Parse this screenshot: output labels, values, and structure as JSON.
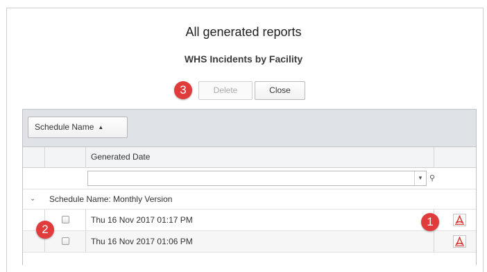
{
  "dialog": {
    "title": "All generated reports",
    "subtitle": "WHS Incidents by Facility"
  },
  "toolbar": {
    "delete_label": "Delete",
    "close_label": "Close"
  },
  "badges": {
    "one": "1",
    "two": "2",
    "three": "3",
    "color": "#e03c3c"
  },
  "grid": {
    "group_chip_label": "Schedule Name",
    "group_chip_sort_icon": "sort-ascending-icon",
    "column_header": "Generated Date",
    "filter_value": "",
    "group_row_label": "Schedule Name: Monthly Version",
    "rows": [
      {
        "date": "Thu 16 Nov 2017 01:17 PM",
        "icon": "pdf-icon"
      },
      {
        "date": "Thu 16 Nov 2017 01:06 PM",
        "icon": "pdf-icon"
      }
    ]
  },
  "colors": {
    "pdf_red": "#d9312b",
    "group_bar": "#dfe3e8"
  }
}
